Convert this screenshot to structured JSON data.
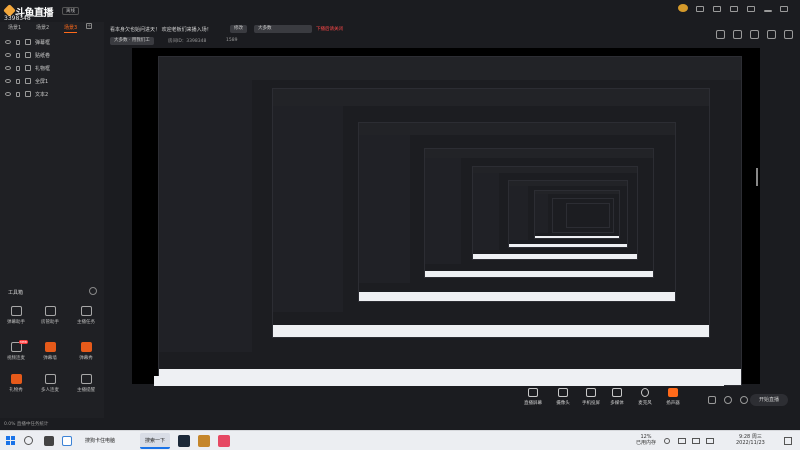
{
  "app": {
    "logo_text": "斗鱼直播伴侣",
    "room_id": "3398348",
    "status_label": "离线"
  },
  "scenes": {
    "tabs": [
      "场景1",
      "场景2",
      "场景3"
    ],
    "active_index": 2
  },
  "sources": [
    {
      "label": "弹幕框"
    },
    {
      "label": "贴纸卷"
    },
    {
      "label": "礼物框"
    },
    {
      "label": "全屏1"
    },
    {
      "label": "文本2"
    }
  ],
  "tools": {
    "title": "工具箱",
    "items": [
      {
        "label": "弹幕助手",
        "icon": "danmu-icon",
        "orange": false
      },
      {
        "label": "房管助手",
        "icon": "admin-icon",
        "orange": false
      },
      {
        "label": "主播任务",
        "icon": "task-icon",
        "orange": false
      },
      {
        "label": "视频连麦",
        "icon": "video-link-icon",
        "orange": false,
        "badge": "new"
      },
      {
        "label": "弹幕墙",
        "icon": "danmu-wall-icon",
        "orange": true
      },
      {
        "label": "弹幕秀",
        "icon": "danmu-show-icon",
        "orange": true
      },
      {
        "label": "礼物秀",
        "icon": "gift-icon",
        "orange": true
      },
      {
        "label": "多人连麦",
        "icon": "multi-link-icon",
        "orange": false
      },
      {
        "label": "主播提醒",
        "icon": "remind-icon",
        "orange": false
      }
    ]
  },
  "topbar": {
    "notice": "看本身欠也始问进天！ 欢迎老板们来播入场！",
    "edit_btn": "修改",
    "category": "大多数",
    "warning": "下播后请关闭",
    "tag_btn": "大多数 · 用我们工",
    "room_label": "房间ID：3398348",
    "viewers": "1589"
  },
  "controls": [
    {
      "label": "直播屏幕",
      "icon": "screen-icon"
    },
    {
      "label": "摄像头",
      "icon": "camera-icon"
    },
    {
      "label": "手机投屏",
      "icon": "phone-cast-icon"
    },
    {
      "label": "多媒体",
      "icon": "media-icon"
    },
    {
      "label": "麦克风",
      "icon": "mic-icon"
    },
    {
      "label": "扬声器",
      "icon": "speaker-icon"
    }
  ],
  "start_button": "开始直播",
  "status_text": "0.0% 直播中任务统计",
  "taskbar": {
    "apps": [
      {
        "label": "搜狗卡住电脑",
        "active": false
      },
      {
        "label": "搜索一下",
        "active": true
      }
    ],
    "tray_battery": "12%",
    "tray_battery_label": "已用内存",
    "time": "9:28 周三",
    "date": "2022/11/23"
  }
}
